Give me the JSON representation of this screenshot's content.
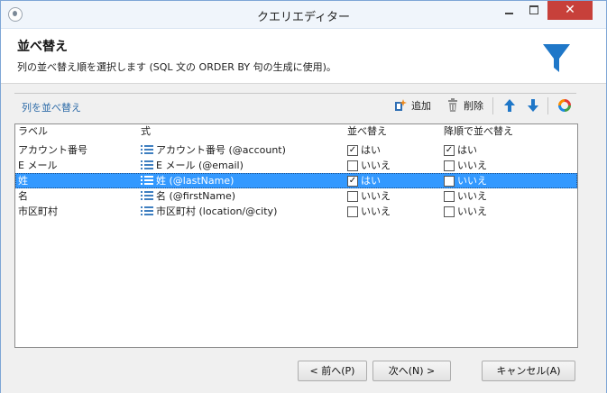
{
  "window": {
    "title": "クエリエディター",
    "close_glyph": "✕"
  },
  "header": {
    "title": "並べ替え",
    "description": "列の並べ替え順を選択します (SQL 文の ORDER BY 句の生成に使用)。"
  },
  "toolbar": {
    "section_label": "列を並べ替え",
    "add_label": "追加",
    "delete_label": "削除"
  },
  "grid": {
    "columns": [
      "ラベル",
      "式",
      "並べ替え",
      "降順で並べ替え"
    ],
    "rows": [
      {
        "label": "アカウント番号",
        "expression": "アカウント番号 (@account)",
        "sort": "はい",
        "sort_checked": true,
        "descending": "はい",
        "descending_checked": true,
        "selected": false
      },
      {
        "label": "E メール",
        "expression": "E メール (@email)",
        "sort": "いいえ",
        "sort_checked": false,
        "descending": "いいえ",
        "descending_checked": false,
        "selected": false
      },
      {
        "label": "姓",
        "expression": "姓 (@lastName)",
        "sort": "はい",
        "sort_checked": true,
        "descending": "いいえ",
        "descending_checked": false,
        "selected": true
      },
      {
        "label": "名",
        "expression": "名 (@firstName)",
        "sort": "いいえ",
        "sort_checked": false,
        "descending": "いいえ",
        "descending_checked": false,
        "selected": false
      },
      {
        "label": "市区町村",
        "expression": "市区町村 (location/@city)",
        "sort": "いいえ",
        "sort_checked": false,
        "descending": "いいえ",
        "descending_checked": false,
        "selected": false
      }
    ]
  },
  "footer": {
    "prev_label": "< 前へ(P)",
    "next_label": "次へ(N) >",
    "cancel_label": "キャンセル(A)"
  },
  "icons": [
    "app-icon",
    "funnel-icon",
    "add-icon",
    "delete-icon",
    "move-up-icon",
    "move-down-icon",
    "refresh-icon",
    "list-icon",
    "checkbox"
  ],
  "colors": {
    "selection": "#3399ff",
    "close_button": "#c7403a",
    "accent": "#1f77c8",
    "link": "#2d6ba8"
  }
}
